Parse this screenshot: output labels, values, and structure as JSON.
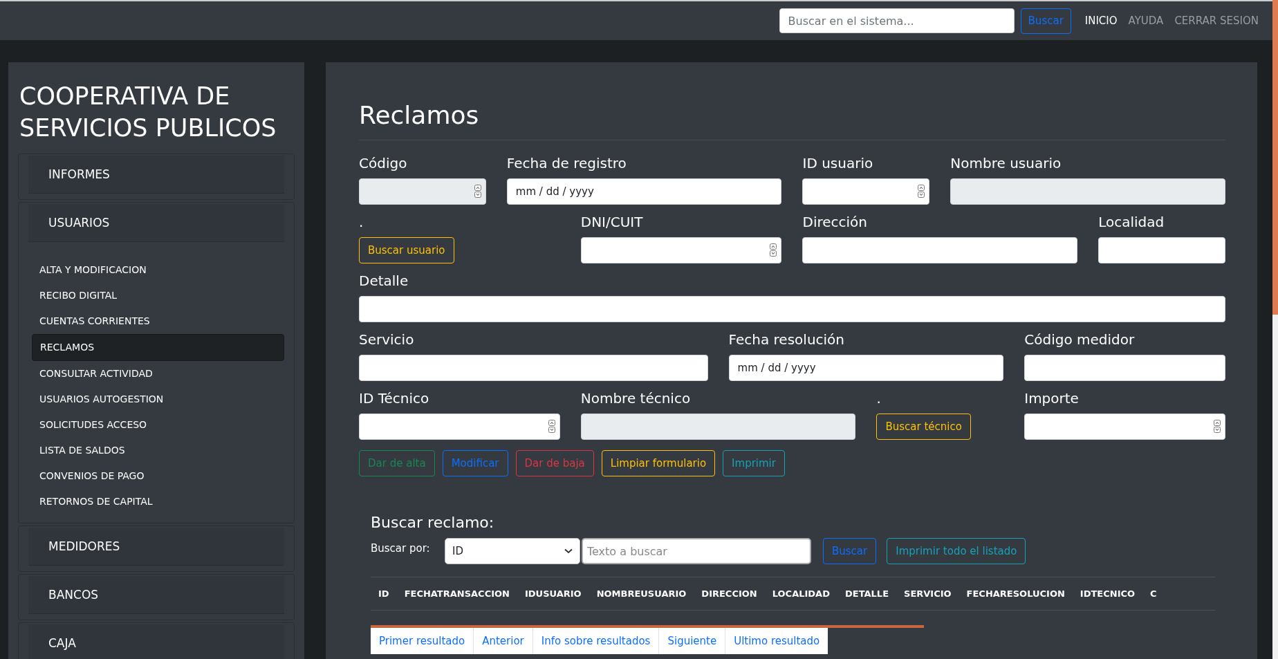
{
  "top_bar": {
    "search": {
      "placeholder": "Buscar en el sistema..."
    },
    "search_button": "Buscar",
    "nav": [
      {
        "label": "INICIO",
        "selected": true
      },
      {
        "label": "AYUDA",
        "selected": false
      },
      {
        "label": "CERRAR SESION",
        "selected": false
      }
    ]
  },
  "sidebar": {
    "title": "COOPERATIVA DE SERVICIOS PUBLICOS",
    "sections": [
      {
        "label": "INFORMES"
      },
      {
        "label": "USUARIOS",
        "items": [
          {
            "label": "ALTA Y MODIFICACION",
            "selected": false
          },
          {
            "label": "RECIBO DIGITAL",
            "selected": false
          },
          {
            "label": "CUENTAS CORRIENTES",
            "selected": false
          },
          {
            "label": "RECLAMOS",
            "selected": true
          },
          {
            "label": "CONSULTAR ACTIVIDAD",
            "selected": false
          },
          {
            "label": "USUARIOS AUTOGESTION",
            "selected": false
          },
          {
            "label": "SOLICITUDES ACCESO",
            "selected": false
          },
          {
            "label": "LISTA DE SALDOS",
            "selected": false
          },
          {
            "label": "CONVENIOS DE PAGO",
            "selected": false
          },
          {
            "label": "RETORNOS DE CAPITAL",
            "selected": false
          }
        ]
      },
      {
        "label": "MEDIDORES"
      },
      {
        "label": "BANCOS"
      },
      {
        "label": "CAJA"
      }
    ]
  },
  "main": {
    "title": "Reclamos",
    "fields": [
      {
        "label": "Código",
        "kind": "number",
        "disabled": true
      },
      {
        "label": "Fecha de registro",
        "kind": "date",
        "placeholder": "mm / dd / yyyy",
        "disabled": false
      },
      {
        "label": "ID usuario",
        "kind": "number",
        "disabled": false
      },
      {
        "label": "Nombre usuario",
        "kind": "text",
        "disabled": true
      },
      {
        "label": ".",
        "kind": "button",
        "button": "Buscar usuario",
        "color": "#ffc107"
      },
      {
        "label": "DNI/CUIT",
        "kind": "number",
        "disabled": false
      },
      {
        "label": "Dirección",
        "kind": "text",
        "disabled": false
      },
      {
        "label": "Localidad",
        "kind": "text",
        "disabled": false
      },
      {
        "label": "Detalle",
        "kind": "text",
        "disabled": false
      },
      {
        "label": "Servicio",
        "kind": "text",
        "disabled": false
      },
      {
        "label": "Fecha resolución",
        "kind": "date",
        "placeholder": "mm / dd / yyyy",
        "disabled": false
      },
      {
        "label": "Código medidor",
        "kind": "text",
        "disabled": false
      },
      {
        "label": "ID Técnico",
        "kind": "number",
        "disabled": false
      },
      {
        "label": "Nombre técnico",
        "kind": "text",
        "disabled": true
      },
      {
        "label": ".",
        "kind": "button",
        "button": "Buscar técnico",
        "color": "#ffc107"
      },
      {
        "label": "Importe",
        "kind": "number",
        "disabled": false
      }
    ],
    "actions": [
      {
        "label": "Dar de alta",
        "color": "#198754"
      },
      {
        "label": "Modificar",
        "color": "#0d6efd"
      },
      {
        "label": "Dar de baja",
        "color": "#dc3545"
      },
      {
        "label": "Limpiar formulario",
        "color": "#ffc107"
      },
      {
        "label": "Imprimir",
        "color": "#17a2b8"
      }
    ],
    "search": {
      "title": "Buscar reclamo:",
      "label": "Buscar por:",
      "select": "ID",
      "placeholder": "Texto a buscar",
      "buttons": [
        {
          "label": "Buscar",
          "color": "#0d6efd"
        },
        {
          "label": "Imprimir todo el listado",
          "color": "#17a2b8"
        }
      ]
    },
    "table": {
      "columns": [
        "ID",
        "FECHATRANSACCION",
        "IDUSUARIO",
        "NOMBREUSUARIO",
        "DIRECCION",
        "LOCALIDAD",
        "DETALLE",
        "SERVICIO",
        "FECHARESOLUCION",
        "IDTECNICO",
        "C"
      ]
    },
    "pagination": [
      "Primer resultado",
      "Anterior",
      "Info sobre resultados",
      "Siguiente",
      "Ultimo resultado"
    ]
  }
}
